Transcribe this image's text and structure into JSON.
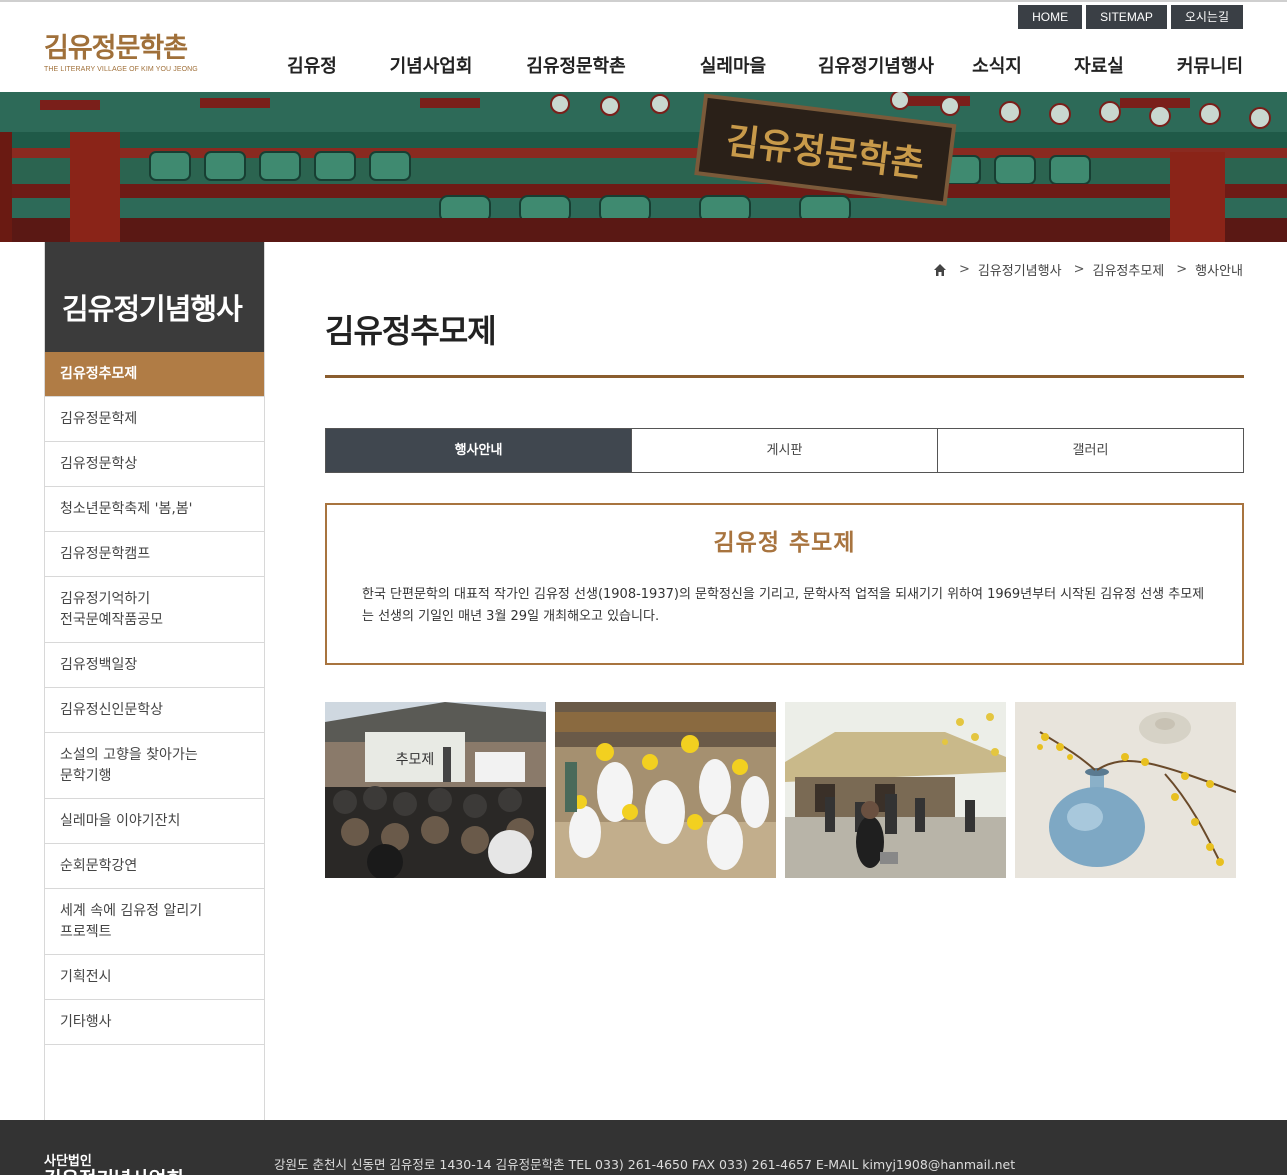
{
  "util_nav": [
    "HOME",
    "SITEMAP",
    "오시는길"
  ],
  "logo": {
    "title": "김유정문학촌",
    "subtitle": "THE LITERARY VILLAGE OF KIM YOU JEONG"
  },
  "gnb": [
    "김유정",
    "기념사업회",
    "김유정문학촌",
    "실레마을",
    "김유정기념행사",
    "소식지",
    "자료실",
    "커뮤니티"
  ],
  "banner_sign": "김유정문학촌",
  "lnb": {
    "title": "김유정기념행사",
    "items": [
      "김유정추모제",
      "김유정문학제",
      "김유정문학상",
      "청소년문학축제 '봄,봄'",
      "김유정문학캠프",
      "김유정기억하기\n전국문예작품공모",
      "김유정백일장",
      "김유정신인문학상",
      "소설의 고향을 찾아가는\n문학기행",
      "실레마을 이야기잔치",
      "순회문학강연",
      "세계 속에 김유정 알리기\n프로젝트",
      "기획전시",
      "기타행사"
    ],
    "active_index": 0
  },
  "breadcrumb": [
    "김유정기념행사",
    "김유정추모제",
    "행사안내"
  ],
  "page_title": "김유정추모제",
  "tabs": [
    "행사안내",
    "게시판",
    "갤러리"
  ],
  "intro": {
    "heading": "김유정 추모제",
    "body": "한국 단편문학의 대표적 작가인 김유정 선생(1908-1937)의 문학정신을 기리고, 문학사적 업적을 되새기기 위하여 1969년부터 시작된 김유정 선생 추모제는 선생의 기일인 매년 3월 29일 개최해오고 있습니다."
  },
  "photo_sign": "추모제",
  "footer": {
    "org_prefix": "사단법인",
    "org_name": "김유정기념사업회",
    "address": "강원도 춘천시 신동면 김유정로 1430-14 김유정문학촌    TEL 033) 261-4650    FAX 033) 261-4657    E-MAIL kimyj1908@hanmail.net"
  },
  "colors": {
    "accent": "#a8743f",
    "dark": "#3b3b3b",
    "tab_active": "#40474f"
  }
}
